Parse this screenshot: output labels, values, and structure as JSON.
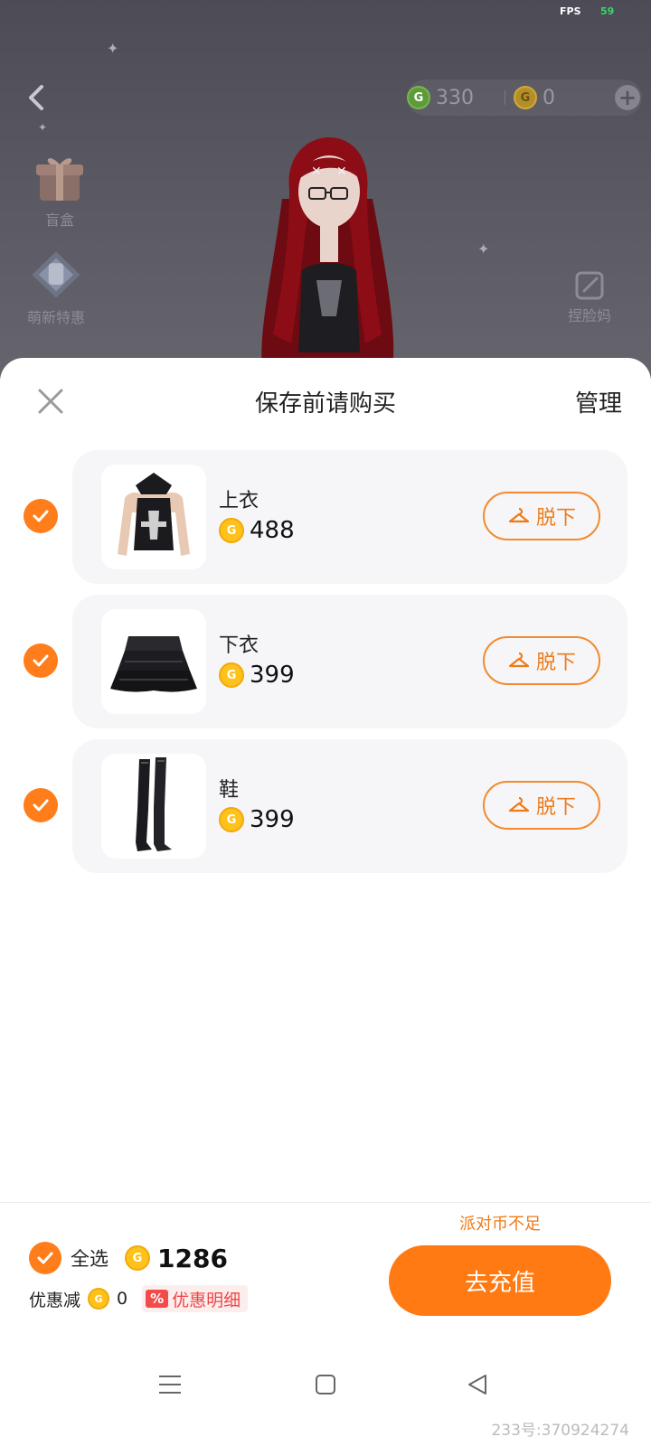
{
  "status": {
    "fps_label": "FPS",
    "fps_value": "59"
  },
  "top_bar": {
    "green_coin_amount": "330",
    "gold_coin_amount": "0",
    "coin_icon_letter": "G"
  },
  "side_menu": {
    "items": [
      {
        "label": "盲盒",
        "icon": "gift-box-icon"
      },
      {
        "label": "萌新特惠",
        "icon": "outfit-bundle-icon"
      }
    ],
    "right_item": {
      "label": "捏脸妈",
      "icon": "edit-face-icon"
    }
  },
  "sheet": {
    "title": "保存前请购买",
    "manage_label": "管理",
    "items": [
      {
        "name": "上衣",
        "price": "488",
        "action_label": "脱下",
        "checked": true,
        "thumb": "black-corset-top"
      },
      {
        "name": "下衣",
        "price": "399",
        "action_label": "脱下",
        "checked": true,
        "thumb": "black-ruffle-skirt"
      },
      {
        "name": "鞋",
        "price": "399",
        "action_label": "脱下",
        "checked": true,
        "thumb": "black-thigh-high-boots"
      }
    ]
  },
  "footer": {
    "select_all_label": "全选",
    "total": "1286",
    "discount_label": "优惠减",
    "discount_amount": "0",
    "discount_detail_badge": "%",
    "discount_detail_label": "优惠明细",
    "insufficient_label": "派对币不足",
    "recharge_label": "去充值"
  },
  "watermark": "233号:370924274",
  "colors": {
    "accent_orange": "#ff7a13",
    "coin_gold": "#ffc21a",
    "discount_red": "#f04545",
    "card_bg": "#f6f6f8"
  }
}
